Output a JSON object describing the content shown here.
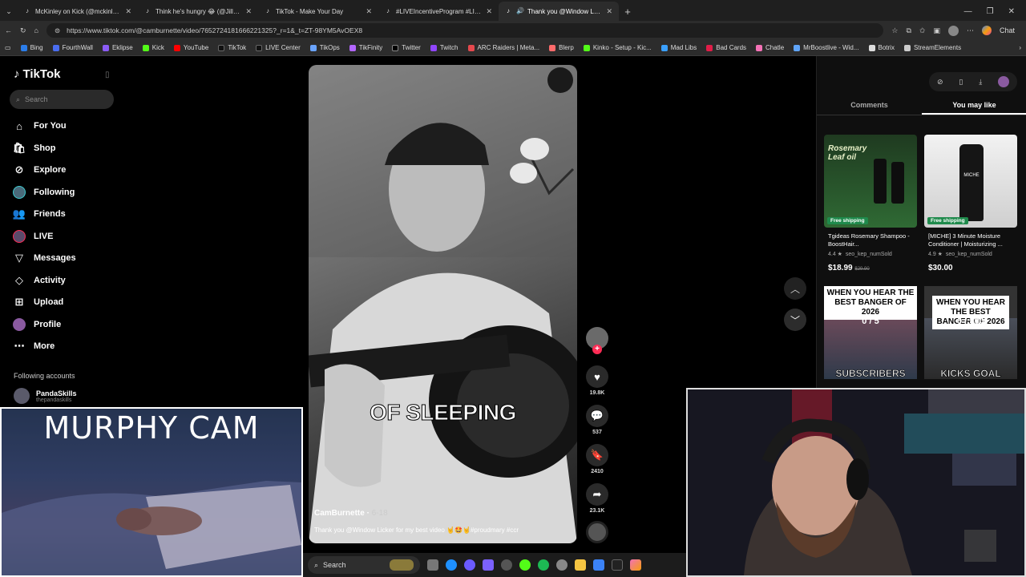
{
  "tabs": [
    {
      "title": "McKinley on Kick (@mckinley.tv) |",
      "icon": "tiktok-icon"
    },
    {
      "title": "Think he's hungry 😂 (@Jillian",
      "icon": "tiktok-icon"
    },
    {
      "title": "TikTok - Make Your Day",
      "icon": "tiktok-icon"
    },
    {
      "title": "#LIVEIncentiveProgram #LIVEFEST",
      "icon": "tiktok-icon"
    },
    {
      "title": "Thank you @Window Licker fo",
      "icon": "tiktok-icon"
    }
  ],
  "url": "https://www.tiktok.com/@camburnette/video/7652724181666221325?_r=1&_t=ZT-98YM5AvOEX8",
  "chat_label": "Chat",
  "bookmarks": [
    "Bing",
    "FourthWall",
    "Eklipse",
    "Kick",
    "YouTube",
    "TikTok",
    "LIVE Center",
    "TikOps",
    "TikFinity",
    "Twitter",
    "Twitch",
    "ARC Raiders | Meta...",
    "Blerp",
    "Kinko - Setup - Kic...",
    "Mad Libs",
    "Bad Cards",
    "Chatle",
    "MrBoostlive - Wid...",
    "Botrix",
    "StreamElements"
  ],
  "sidebar": {
    "logo": "TikTok",
    "search_placeholder": "Search",
    "nav": [
      "For You",
      "Shop",
      "Explore",
      "Following",
      "Friends",
      "LIVE",
      "Messages",
      "Activity",
      "Upload",
      "Profile",
      "More"
    ],
    "following_accounts_label": "Following accounts",
    "account_name": "PandaSkills",
    "account_handle": "thepandaskills"
  },
  "video": {
    "caption": "OF SLEEPING",
    "author": "CamBurnette",
    "date": "6-18",
    "description": "Thank you @Window Licker for my best video 🤘🤩🤘#proudmary #ccr"
  },
  "actions": {
    "likes": "19.8K",
    "comments": "537",
    "saves": "2410",
    "shares": "23.1K"
  },
  "right_panel": {
    "tabs": [
      "Comments",
      "You may like"
    ],
    "active_tab": "You may like",
    "products": [
      {
        "image_text": "Rosemary Leaf oil",
        "badge": "Free shipping",
        "title": "Tgideas Rosemary Shampoo - BoostHair...",
        "rating": "4.4 ★",
        "sold": "seo_kep_numSold",
        "price": "$18.99",
        "old_price": "$29.90"
      },
      {
        "image_text": "MICHE",
        "badge": "Free shipping",
        "title": "[MICHE] 3 Minute Moisture Conditioner | Moisturizing ...",
        "rating": "4.9 ★",
        "sold": "seo_kep_numSold",
        "price": "$30.00",
        "old_price": ""
      }
    ],
    "thumbs": [
      {
        "top": "WHEN YOU HEAR THE BEST BANGER OF 2026",
        "bottom": "SUBSCRIBERS",
        "counter": "0 / 5"
      },
      {
        "top": "WHEN YOU HEAR THE BEST BANGER OF 2026",
        "bottom": "KICKS GOAL",
        "counter": "0 / 500"
      }
    ]
  },
  "overlay": {
    "murphy_title": "MURPHY CAM"
  },
  "taskbar": {
    "search_placeholder": "Search"
  }
}
